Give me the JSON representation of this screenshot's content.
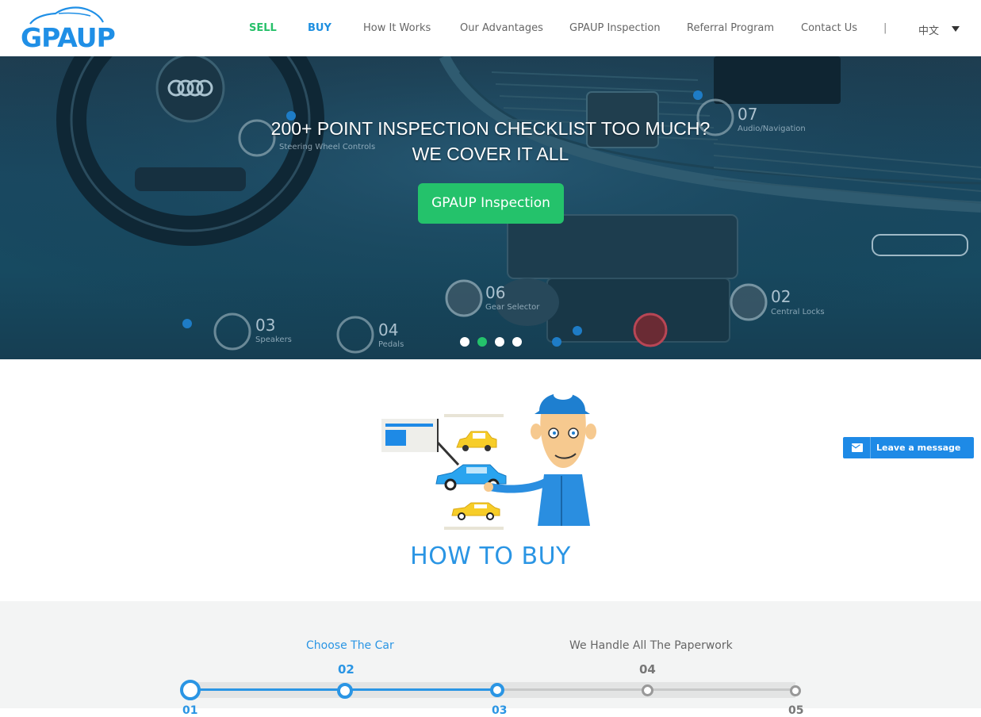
{
  "header": {
    "logo_text": "GPAUP",
    "nav": [
      {
        "label": "SELL"
      },
      {
        "label": "BUY"
      },
      {
        "label": "How It Works"
      },
      {
        "label": "Our Advantages"
      },
      {
        "label": "GPAUP Inspection"
      },
      {
        "label": "Referral Program"
      },
      {
        "label": "Contact Us"
      }
    ],
    "separator": "|",
    "language": "中文"
  },
  "hero": {
    "title_line1": "200+ POINT INSPECTION CHECKLIST TOO MUCH?",
    "title_line2": "WE COVER IT ALL",
    "button_label": "GPAUP Inspection",
    "active_slide": 2,
    "slide_count": 4,
    "features": [
      {
        "num": "07",
        "label": "Audio/Navigation"
      },
      {
        "num": "",
        "label": "Steering Wheel Controls"
      },
      {
        "num": "06",
        "label": "Gear Selector"
      },
      {
        "num": "02",
        "label": "Central Locks"
      },
      {
        "num": "03",
        "label": "Speakers"
      },
      {
        "num": "04",
        "label": "Pedals"
      }
    ]
  },
  "howto": {
    "title": "HOW TO BUY"
  },
  "chat": {
    "label": "Leave a message",
    "icon": "envelope-icon"
  },
  "steps": {
    "items": [
      {
        "num": "01",
        "label": ""
      },
      {
        "num": "02",
        "label": "Choose The Car"
      },
      {
        "num": "03",
        "label": ""
      },
      {
        "num": "04",
        "label": "We Handle All The Paperwork"
      },
      {
        "num": "05",
        "label": ""
      }
    ],
    "progress_step": 3
  },
  "colors": {
    "green": "#24c26b",
    "blue": "#2a95e4",
    "chat_blue": "#1e8ae6"
  }
}
